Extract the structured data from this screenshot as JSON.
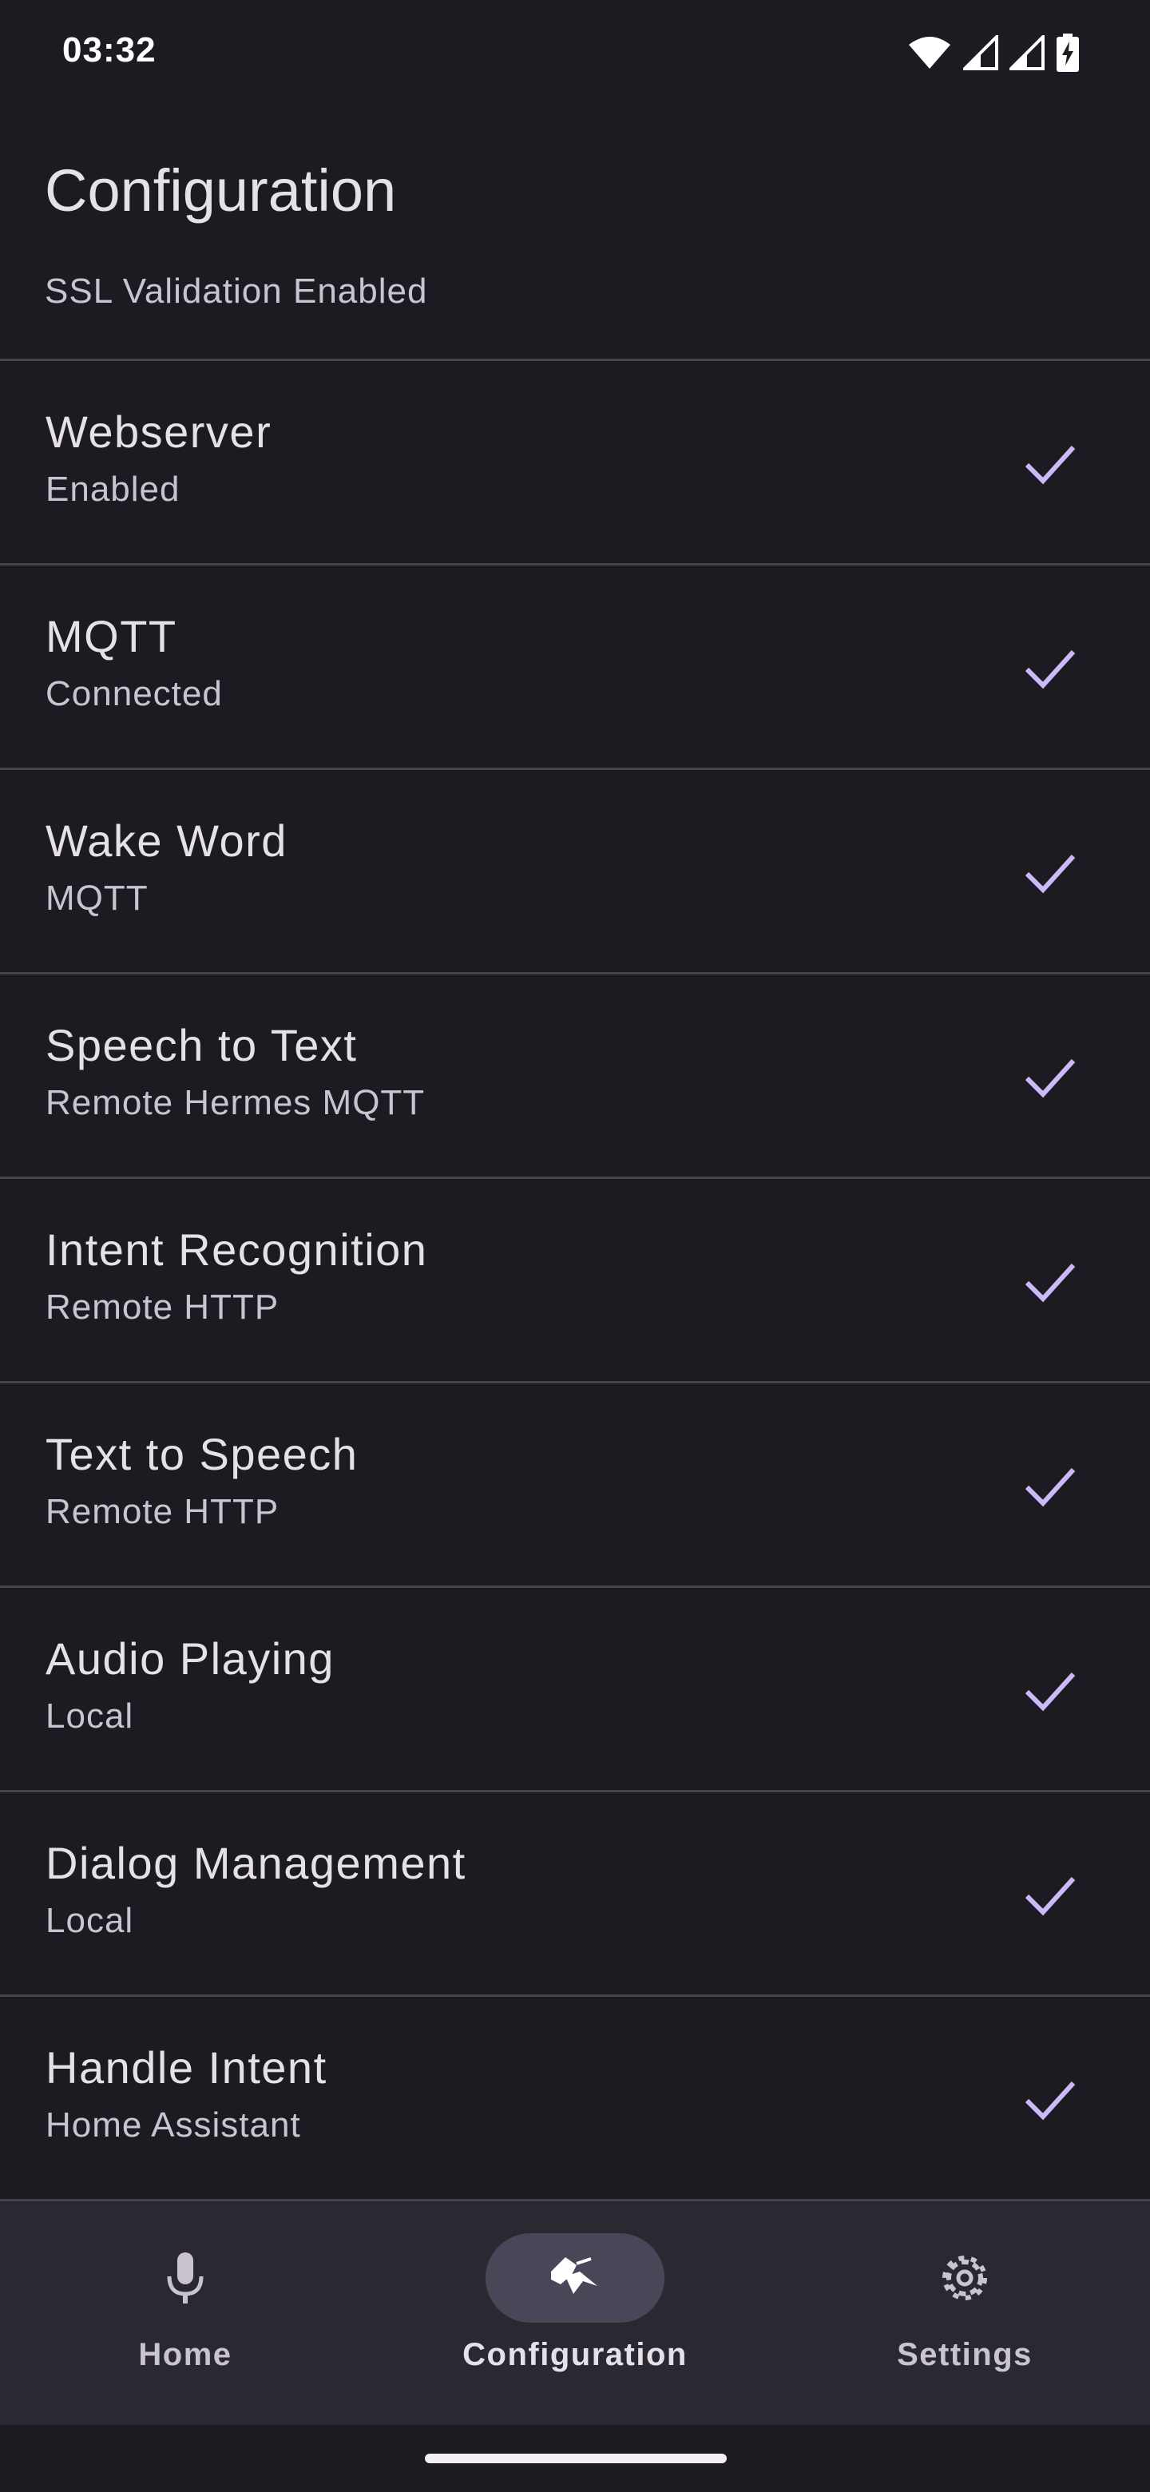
{
  "status_bar": {
    "time": "03:32",
    "icons": [
      "wifi-icon",
      "signal-icon",
      "signal-icon",
      "battery-charging-icon"
    ]
  },
  "header": {
    "title": "Configuration"
  },
  "partial_item": {
    "subtitle": "SSL Validation Enabled"
  },
  "items": [
    {
      "title": "Webserver",
      "subtitle": "Enabled",
      "status_icon": "check-icon"
    },
    {
      "title": "MQTT",
      "subtitle": "Connected",
      "status_icon": "check-icon"
    },
    {
      "title": "Wake Word",
      "subtitle": "MQTT",
      "status_icon": "check-icon"
    },
    {
      "title": "Speech to Text",
      "subtitle": "Remote Hermes MQTT",
      "status_icon": "check-icon"
    },
    {
      "title": "Intent Recognition",
      "subtitle": "Remote HTTP",
      "status_icon": "check-icon"
    },
    {
      "title": "Text to Speech",
      "subtitle": "Remote HTTP",
      "status_icon": "check-icon"
    },
    {
      "title": "Audio Playing",
      "subtitle": "Local",
      "status_icon": "check-icon"
    },
    {
      "title": "Dialog Management",
      "subtitle": "Local",
      "status_icon": "check-icon"
    },
    {
      "title": "Handle Intent",
      "subtitle": "Home Assistant",
      "status_icon": "check-icon"
    }
  ],
  "bottom_nav": {
    "items": [
      {
        "label": "Home",
        "icon": "microphone-icon",
        "active": false
      },
      {
        "label": "Configuration",
        "icon": "configuration-icon",
        "active": true
      },
      {
        "label": "Settings",
        "icon": "gear-icon",
        "active": false
      }
    ]
  },
  "colors": {
    "background": "#1d1b22",
    "divider": "#46434c",
    "accent_check": "#cdb9f5",
    "nav_background": "#2a2831",
    "nav_active_pill": "#4a4557"
  }
}
